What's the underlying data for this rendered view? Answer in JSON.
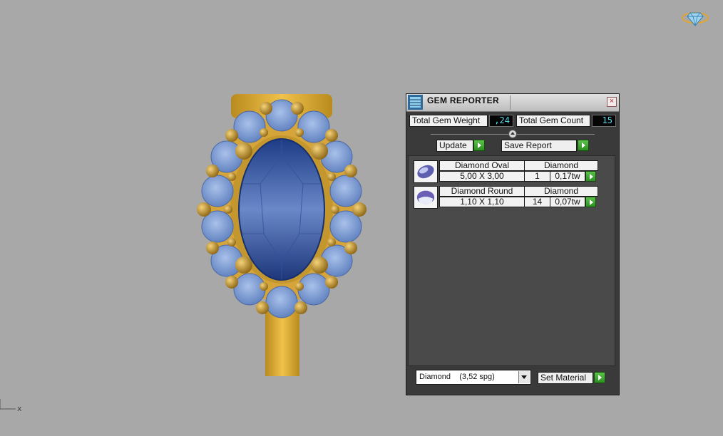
{
  "viewport": {
    "axis_label": "x"
  },
  "panel": {
    "title": "GEM REPORTER",
    "close_symbol": "×",
    "total_weight_label": "Total Gem Weight",
    "total_weight_value": ",24",
    "total_count_label": "Total Gem Count",
    "total_count_value": "15",
    "update_label": "Update",
    "save_report_label": "Save Report",
    "gems": [
      {
        "name": "Diamond Oval",
        "material": "Diamond",
        "size": "5,00 X 3,00",
        "count": "1",
        "weight": "0,17tw",
        "thumb_icon": "oval-gem-icon"
      },
      {
        "name": "Diamond Round",
        "material": "Diamond",
        "size": "1,10 X 1,10",
        "count": "14",
        "weight": "0,07tw",
        "thumb_icon": "round-gem-icon"
      }
    ],
    "material_select_value": "Diamond    (3,52 spg)",
    "set_material_label": "Set Material"
  },
  "colors": {
    "gold": "#d8a52c",
    "sapphire": "#2e4f9a",
    "side_stone": "#7f9fd6",
    "value_text": "#5ad8e8",
    "green_button": "#3aa02c"
  }
}
